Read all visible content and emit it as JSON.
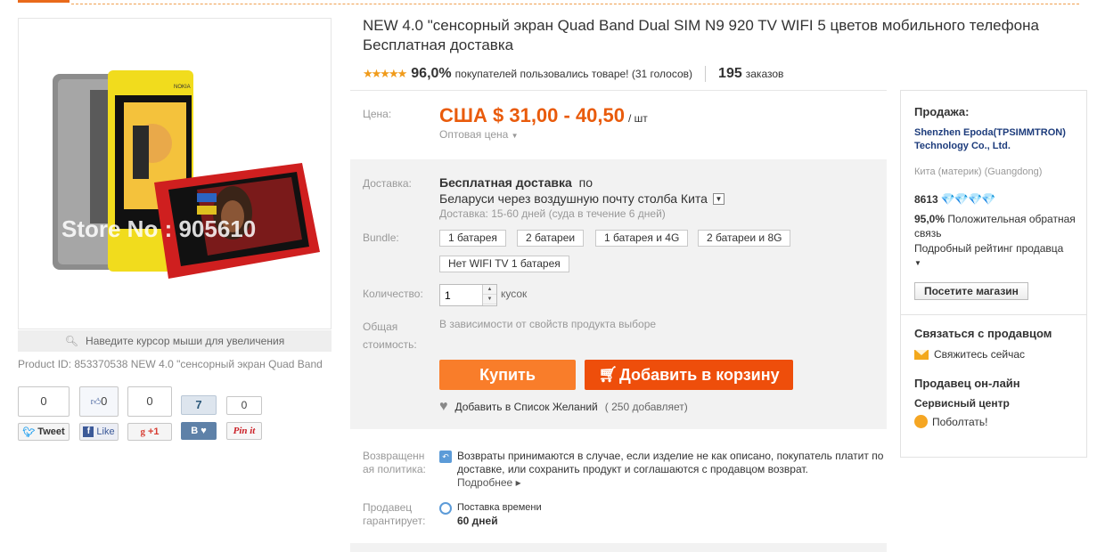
{
  "product": {
    "title": "NEW 4.0 \"сенсорный экран Quad Band Dual SIM N9 920 TV WIFI 5 цветов мобильного телефона Бесплатная доставка",
    "image_watermark": "Store No : 905610",
    "zoom_hint": "Наведите курсор мыши для увеличения",
    "product_id": "Product ID: 853370538 NEW 4.0 \"сенсорный экран Quad Band"
  },
  "rating": {
    "stars": "★★★★★",
    "percent": "96,0%",
    "votes_text": "покупателей пользовались товаре! (31 голосов)",
    "orders_count": "195",
    "orders_label": "заказов"
  },
  "price": {
    "label": "Цена:",
    "value": "США $ 31,00 - 40,50",
    "unit": "/ шт",
    "wholesale": "Оптовая цена"
  },
  "delivery": {
    "label": "Доставка:",
    "free": "Бесплатная доставка",
    "po": "по",
    "route": "Беларуси через воздушную почту столба Кита",
    "time": "Доставка: 15-60 дней (суда в течение 6 дней)"
  },
  "bundle": {
    "label": "Bundle:",
    "options": [
      "1 батарея",
      "2 батареи",
      "1 батарея и 4G",
      "2 батареи и 8G",
      "Нет WIFI TV 1 батарея"
    ]
  },
  "quantity": {
    "label": "Количество:",
    "value": "1",
    "unit": "кусок"
  },
  "total": {
    "label_line1": "Общая",
    "label_line2": "стоимость:",
    "text": "В зависимости от свойств продукта выборе"
  },
  "actions": {
    "buy": "Купить",
    "add_to_cart": "Добавить в корзину",
    "wishlist": "Добавить в Список Желаний",
    "wishlist_count": "( 250 добавляет)"
  },
  "returns": {
    "label_line1": "Возвращенн",
    "label_line2": "ая политика:",
    "text": "Возвраты принимаются в случае, если изделие не как описано, покупатель платит по доставке, или сохранить продукт и соглашаются с продавцом возврат.",
    "more": "Подробнее ▸"
  },
  "guarantee": {
    "label_line1": "Продавец",
    "label_line2": "гарантирует:",
    "title": "Поставка времени",
    "days": "60 дней"
  },
  "social": {
    "tweet_count": "0",
    "tweet_label": "Tweet",
    "like_count": "0",
    "like_label": "Like",
    "gplus_count": "0",
    "gplus_label": "+1",
    "vk_count": "7",
    "vk_label": "В",
    "pin_count": "0",
    "pin_label": "Pin it"
  },
  "seller": {
    "heading": "Продажа:",
    "name": "Shenzhen Epoda(TPSIMMTRON) Technology Co., Ltd.",
    "location": "Кита (материк) (Guangdong)",
    "score": "8613",
    "diamonds": "💎💎💎💎",
    "feedback_pct": "95,0%",
    "feedback_text": "Положительная обратная связь",
    "detailed_rating": "Подробный рейтинг продавца",
    "visit_store": "Посетите магазин",
    "contact_heading": "Связаться с продавцом",
    "contact_now": "Свяжитесь сейчас",
    "online_heading": "Продавец он-лайн",
    "service_center": "Сервисный центр",
    "chat": "Поболтать!"
  },
  "colors": {
    "price_orange": "#e95b0c",
    "buy_button": "#f97d2a",
    "cart_button": "#ee4e0b",
    "seller_link": "#1d3c7c"
  }
}
